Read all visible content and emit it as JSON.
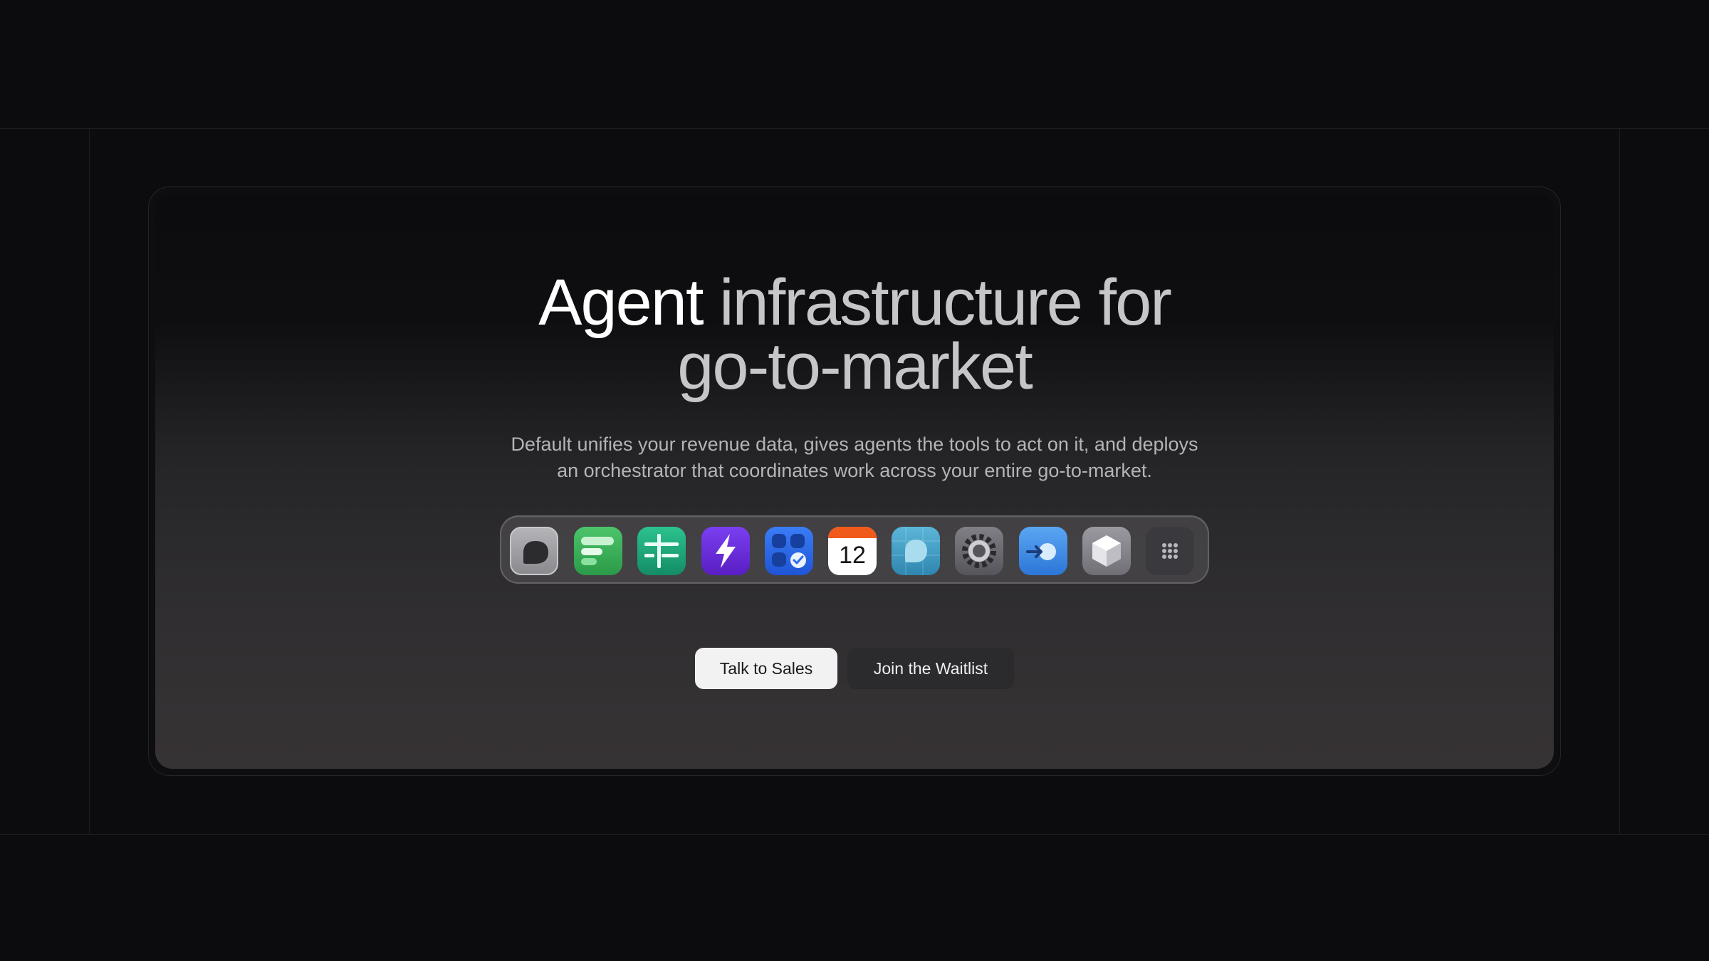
{
  "hero": {
    "headline_line1_part1": "Agent ",
    "headline_line1_part2": "infrastructure for",
    "headline_line2": "go-to-market",
    "subtext_line1": "Default unifies your revenue data, gives agents the tools to act on it, and deploys",
    "subtext_line2": "an orchestrator that coordinates work across your entire go-to-market."
  },
  "dock": {
    "apps": [
      {
        "icon": "gray-chat-bubble-icon",
        "color": "#8e8e92"
      },
      {
        "icon": "green-bars-icon",
        "color": "#3db35a"
      },
      {
        "icon": "teal-grid-icon",
        "color": "#1fa57a"
      },
      {
        "icon": "purple-bolt-icon",
        "color": "#6a2ad9"
      },
      {
        "icon": "blue-tasks-icon",
        "color": "#2a6bf0"
      },
      {
        "icon": "calendar-icon",
        "label": "12",
        "color": "#f05a1a"
      },
      {
        "icon": "teal-bubble-icon",
        "color": "#3c9fc8"
      },
      {
        "icon": "settings-gear-icon",
        "color": "#6a6a70"
      },
      {
        "icon": "blue-arrow-icon",
        "color": "#3a8ee8"
      },
      {
        "icon": "cube-icon",
        "color": "#8a8a90"
      },
      {
        "icon": "app-grid-icon",
        "color": "#3a3a3e"
      }
    ]
  },
  "actions": {
    "primary_label": "Talk to Sales",
    "secondary_label": "Join the Waitlist"
  }
}
